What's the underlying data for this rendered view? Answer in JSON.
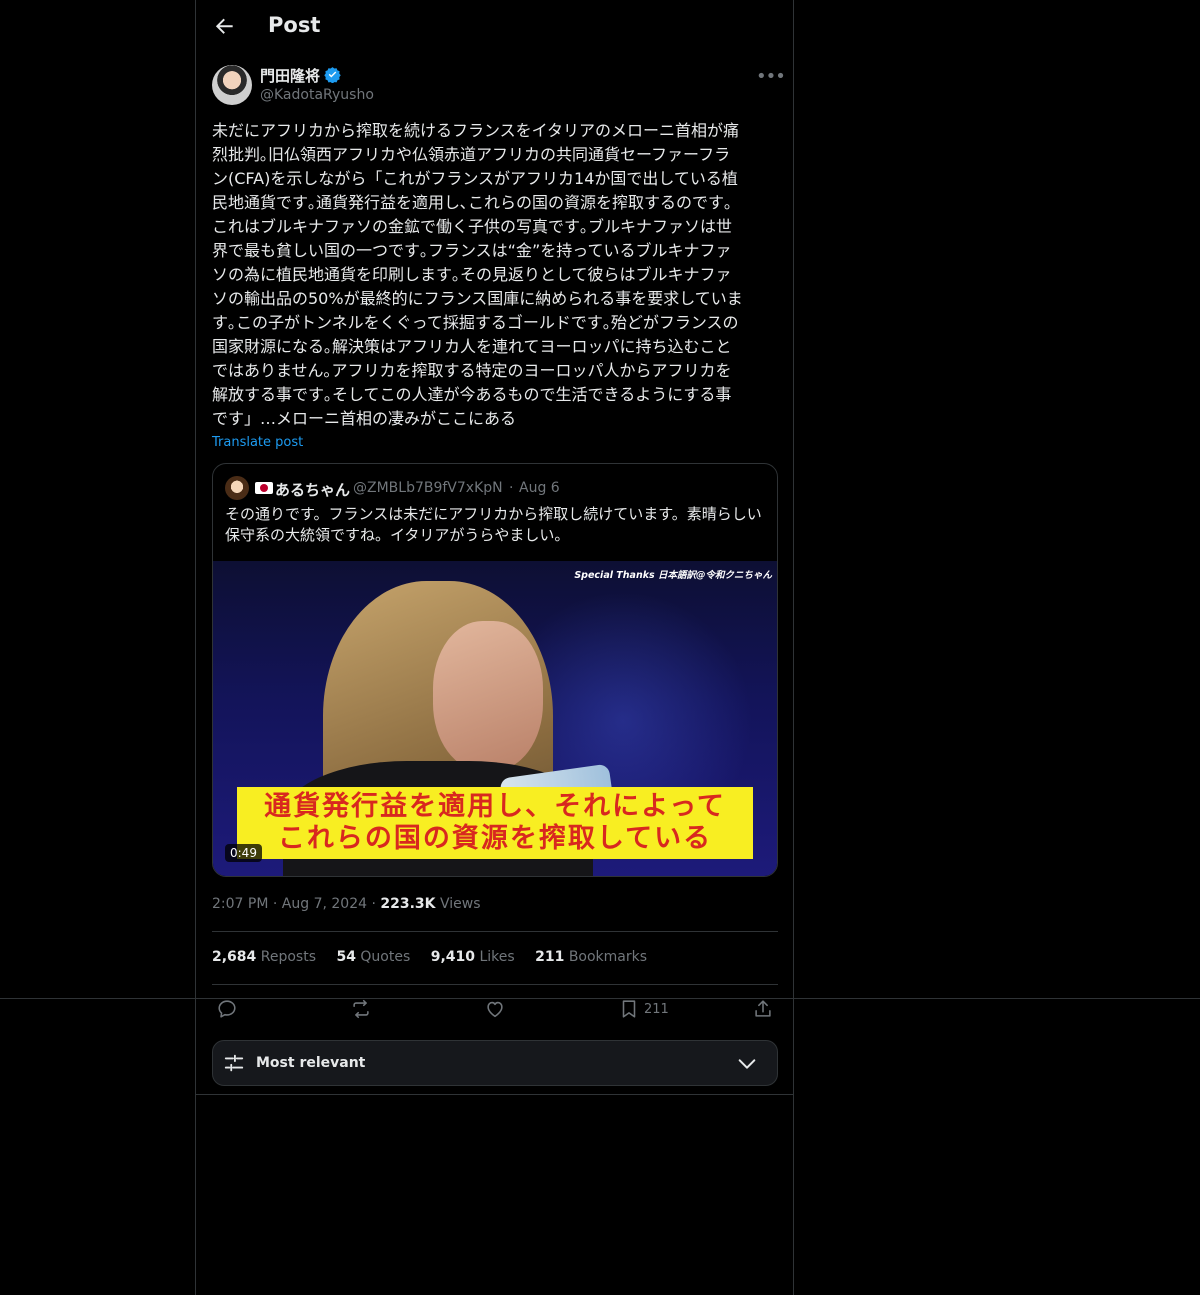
{
  "header": {
    "title": "Post"
  },
  "author": {
    "name": "門田隆将",
    "handle": "@KadotaRyusho"
  },
  "post": {
    "text": "未だにアフリカから搾取を続けるフランスをイタリアのメローニ首相が痛\n烈批判｡旧仏領西アフリカや仏領赤道アフリカの共同通貨セーファーフラ\nン(CFA)を示しながら「これがフランスがアフリカ14か国で出している植\n民地通貨です｡通貨発行益を適用し､これらの国の資源を搾取するのです｡\nこれはブルキナファソの金鉱で働く子供の写真です｡ブルキナファソは世\n界で最も貧しい国の一つです｡フランスは“金”を持っているブルキナファ\nソの為に植民地通貨を印刷します｡その見返りとして彼らはブルキナファ\nソの輸出品の50%が最終的にフランス国庫に納められる事を要求していま\nす｡この子がトンネルをくぐって採掘するゴールドです｡殆どがフランスの\n国家財源になる｡解決策はアフリカ人を連れてヨーロッパに持ち込むこと\nではありません｡アフリカを搾取する特定のヨーロッパ人からアフリカを\n解放する事です｡そしてこの人達が今あるもので生活できるようにする事\nです」…メローニ首相の凄みがここにある",
    "translate_label": "Translate post",
    "time": "2:07 PM",
    "date": "Aug 7, 2024",
    "sep": "·",
    "views_count": "223.3K",
    "views_label": "Views"
  },
  "quote": {
    "name": "あるちゃん",
    "handle": "@ZMBLb7B9fV7xKpN",
    "sep": "·",
    "date": "Aug 6",
    "text": "その通りです。フランスは未だにアフリカから搾取し続けています。素晴らしい\n保守系の大統領ですね。イタリアがうらやましい。",
    "video": {
      "credit": "Special Thanks 日本語訳@令和クニちゃん",
      "caption_line1": "通貨発行益を適用し、それによって",
      "caption_line2": "これらの国の資源を搾取している",
      "duration": "0:49"
    }
  },
  "stats": {
    "reposts_count": "2,684",
    "reposts_label": "Reposts",
    "quotes_count": "54",
    "quotes_label": "Quotes",
    "likes_count": "9,410",
    "likes_label": "Likes",
    "bookmarks_count": "211",
    "bookmarks_label": "Bookmarks"
  },
  "actions": {
    "reply_icon": "reply-icon",
    "repost_icon": "repost-icon",
    "like_icon": "heart-icon",
    "bookmark_icon": "bookmark-icon",
    "bookmark_count": "211",
    "share_icon": "share-icon"
  },
  "sort": {
    "label": "Most relevant"
  },
  "colors": {
    "accent": "#1d9bf0",
    "text": "#e7e9ea",
    "muted": "#71767b",
    "border": "#2f3336",
    "background": "#000000"
  }
}
